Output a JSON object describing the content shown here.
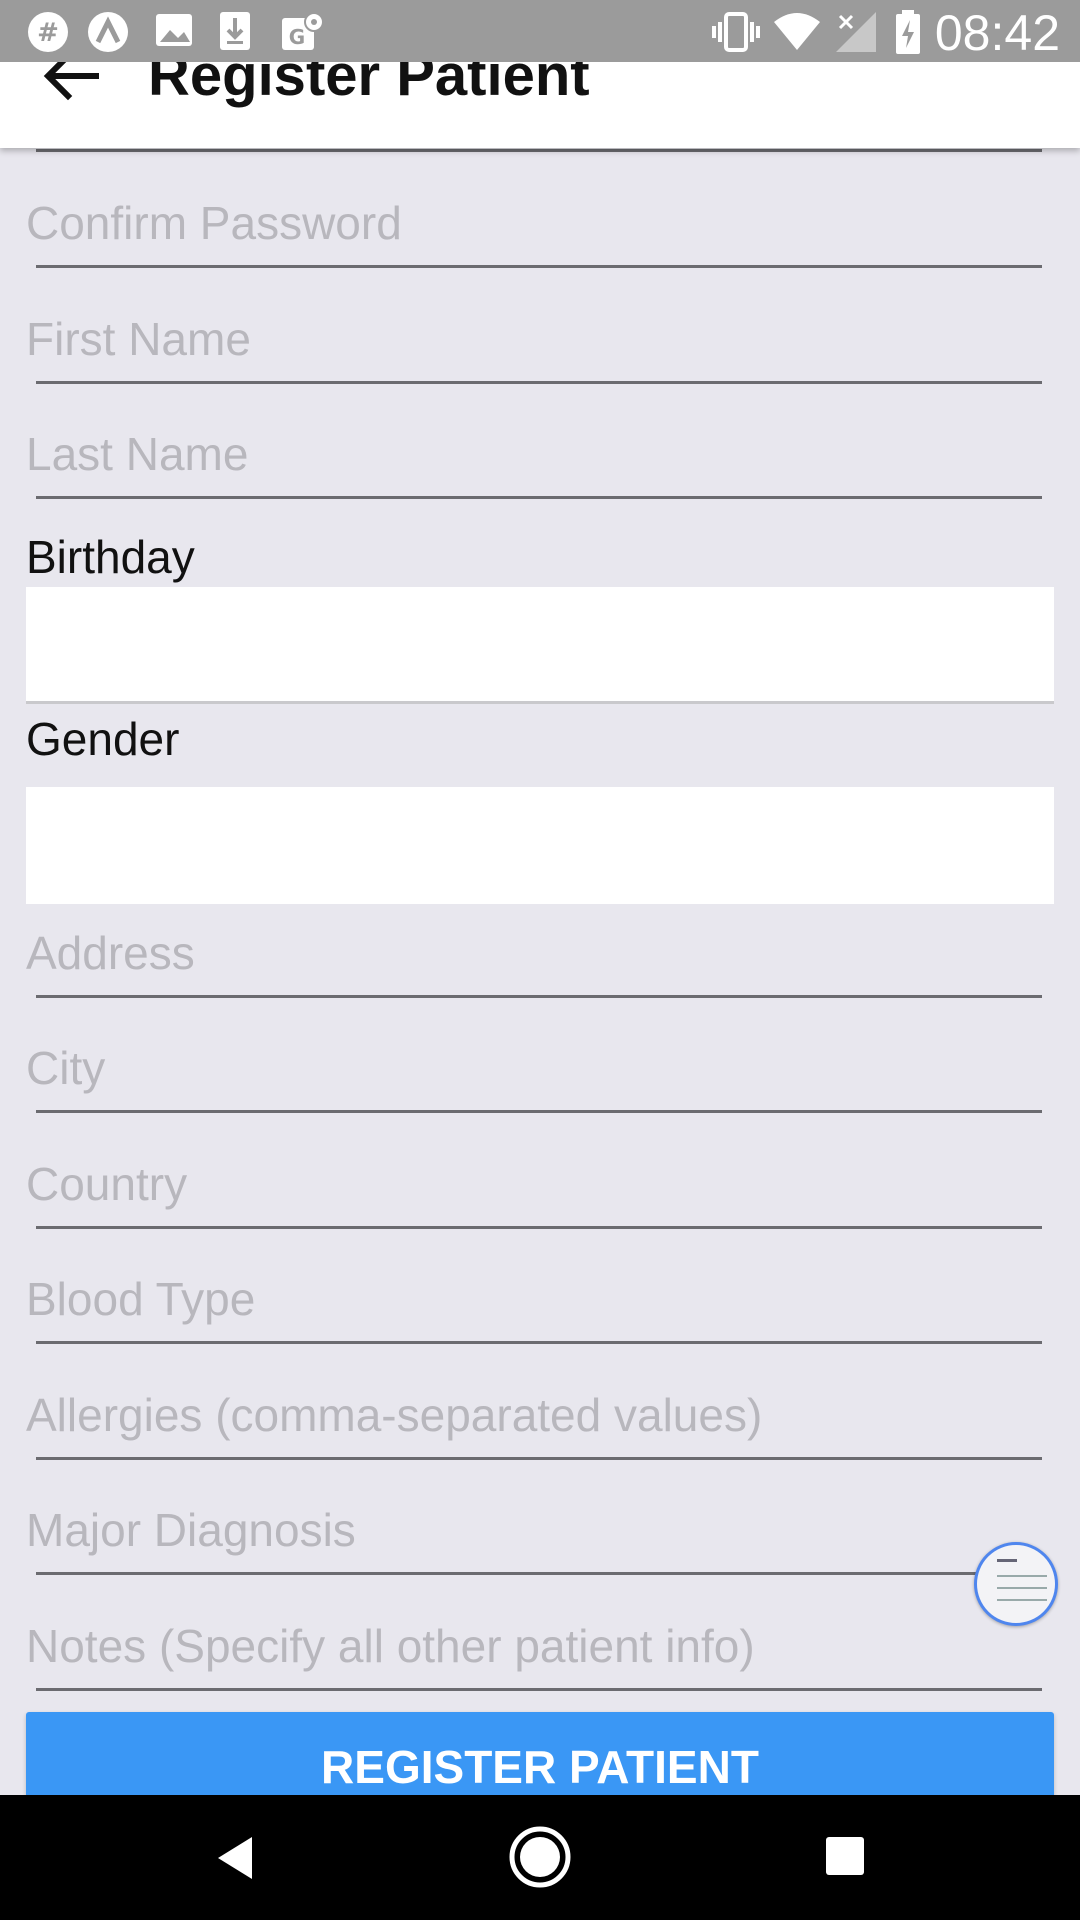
{
  "status_bar": {
    "time": "08:42",
    "left_icons": [
      "hash-icon",
      "lambda-icon",
      "image-icon",
      "download-icon",
      "maps-icon"
    ],
    "right_icons": [
      "vibrate-icon",
      "wifi-icon",
      "no-signal-icon",
      "battery-charging-icon"
    ]
  },
  "app_bar": {
    "title": "Register Patient",
    "back_icon": "arrow-back-icon"
  },
  "form": {
    "confirm_password_placeholder": "Confirm Password",
    "first_name_placeholder": "First Name",
    "last_name_placeholder": "Last Name",
    "birthday_label": "Birthday",
    "gender_label": "Gender",
    "address_placeholder": "Address",
    "city_placeholder": "City",
    "country_placeholder": "Country",
    "blood_type_placeholder": "Blood Type",
    "allergies_placeholder": "Allergies (comma-separated values)",
    "major_diagnosis_placeholder": "Major Diagnosis",
    "notes_placeholder": "Notes (Specify all other patient info)",
    "submit_label": "REGISTER PATIENT"
  },
  "colors": {
    "accent": "#3a97f5",
    "background": "#e8e7ee",
    "status_bar": "#9b9b9b"
  },
  "nav_bar": {
    "icons": [
      "back-triangle-icon",
      "home-circle-icon",
      "recents-square-icon"
    ]
  }
}
